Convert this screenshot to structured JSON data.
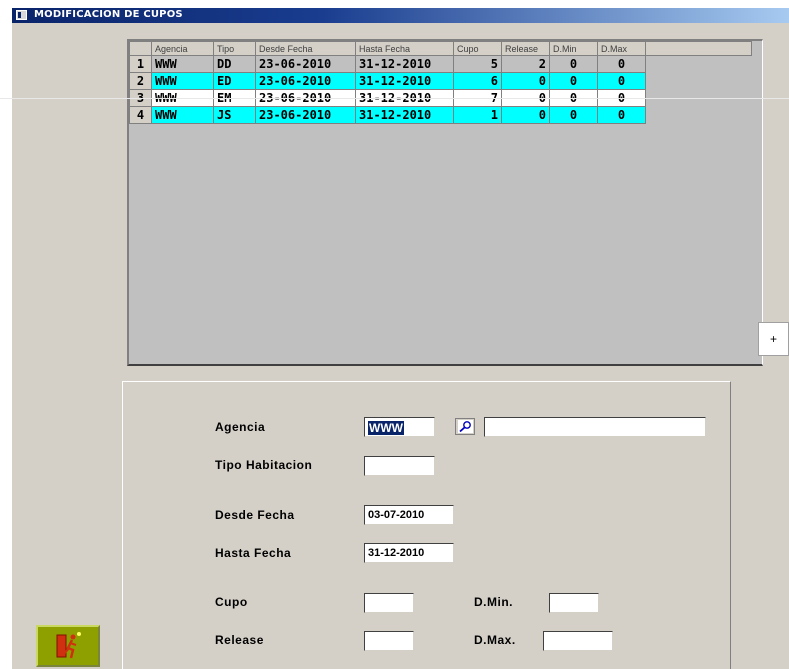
{
  "window": {
    "title": "MODIFICACION DE CUPOS"
  },
  "grid": {
    "columns": [
      "",
      "Agencia",
      "Tipo",
      "Desde Fecha",
      "Hasta Fecha",
      "Cupo",
      "Release",
      "D.Min",
      "D.Max",
      ""
    ],
    "rows": [
      {
        "n": "1",
        "agencia": "WWW",
        "tipo": "DD",
        "desde": "23-06-2010",
        "hasta": "31-12-2010",
        "cupo": "5",
        "release": "2",
        "dmin": "0",
        "dmax": "0",
        "style": "gray"
      },
      {
        "n": "2",
        "agencia": "WWW",
        "tipo": "ED",
        "desde": "23-06-2010",
        "hasta": "31-12-2010",
        "cupo": "6",
        "release": "0",
        "dmin": "0",
        "dmax": "0",
        "style": "cyan"
      },
      {
        "n": "3",
        "agencia": "WWW",
        "tipo": "EM",
        "desde": "23-06-2010",
        "hasta": "31-12-2010",
        "cupo": "7",
        "release": "0",
        "dmin": "0",
        "dmax": "0",
        "style": "white"
      },
      {
        "n": "4",
        "agencia": "WWW",
        "tipo": "JS",
        "desde": "23-06-2010",
        "hasta": "31-12-2010",
        "cupo": "1",
        "release": "0",
        "dmin": "0",
        "dmax": "0",
        "style": "cyan"
      }
    ]
  },
  "side_button": {
    "label": "+"
  },
  "form": {
    "agencia_label": "Agencia",
    "agencia_value": "WWW",
    "agencia_desc": "",
    "tipo_label": "Tipo Habitacion",
    "tipo_value": "",
    "desde_label": "Desde Fecha",
    "desde_value": "03-07-2010",
    "hasta_label": "Hasta Fecha",
    "hasta_value": "31-12-2010",
    "cupo_label": "Cupo",
    "cupo_value": "",
    "dmin_label": "D.Min.",
    "dmin_value": "",
    "release_label": "Release",
    "release_value": "",
    "dmax_label": "D.Max.",
    "dmax_value": ""
  },
  "icons": {
    "search": "search-icon",
    "exit": "exit-door-icon"
  },
  "colors": {
    "title_bar": "#0a246a",
    "row_highlight": "#00ffff",
    "panel": "#d4d0c8",
    "exit_button": "#8ea000"
  }
}
